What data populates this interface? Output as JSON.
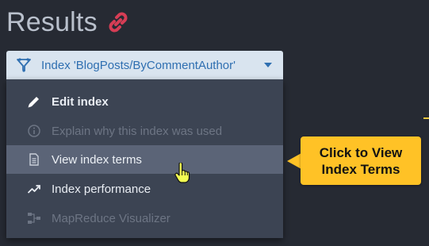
{
  "header": {
    "title": "Results",
    "link_icon": "link-icon",
    "link_icon_color": "#d63d55"
  },
  "index_selector": {
    "label": "Index 'BlogPosts/ByCommentAuthor'",
    "icon": "filter-icon",
    "background": "#d9e4ef",
    "text_color": "#2f6fb1"
  },
  "menu": {
    "items": [
      {
        "label": "Edit index",
        "icon": "pencil-icon",
        "enabled": true
      },
      {
        "label": "Explain why this index was used",
        "icon": "info-icon",
        "enabled": false
      },
      {
        "label": "View index terms",
        "icon": "document-icon",
        "enabled": true,
        "highlighted": true
      },
      {
        "label": "Index performance",
        "icon": "trend-icon",
        "enabled": true
      },
      {
        "label": "MapReduce Visualizer",
        "icon": "mapreduce-icon",
        "enabled": false
      }
    ]
  },
  "callout": {
    "line1": "Click to View",
    "line2": "Index Terms",
    "color": "#ffc226"
  },
  "cursor": {
    "icon": "hand-pointer-icon"
  }
}
